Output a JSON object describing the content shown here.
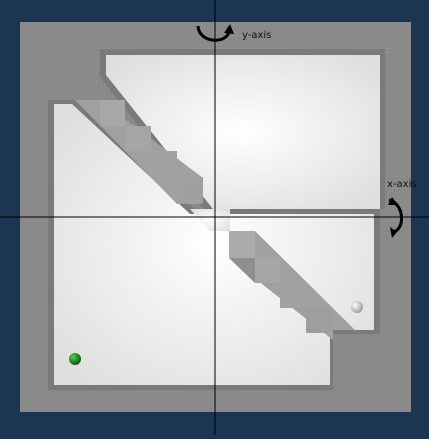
{
  "axes": {
    "y_label": "y-axis",
    "x_label": "x-axis"
  },
  "balls": [
    {
      "name": "green-ball",
      "color": "#1f7a1f"
    },
    {
      "name": "white-ball",
      "color": "#e8e8e8"
    }
  ],
  "colors": {
    "background": "#1c3553",
    "board": "#8c8c8c",
    "floor": "#f4f4f4",
    "wall_block": "#a4a4a4",
    "axis_line": "#000000"
  },
  "icons": [
    "rotate-y-arrow-icon",
    "rotate-x-arrow-icon"
  ]
}
